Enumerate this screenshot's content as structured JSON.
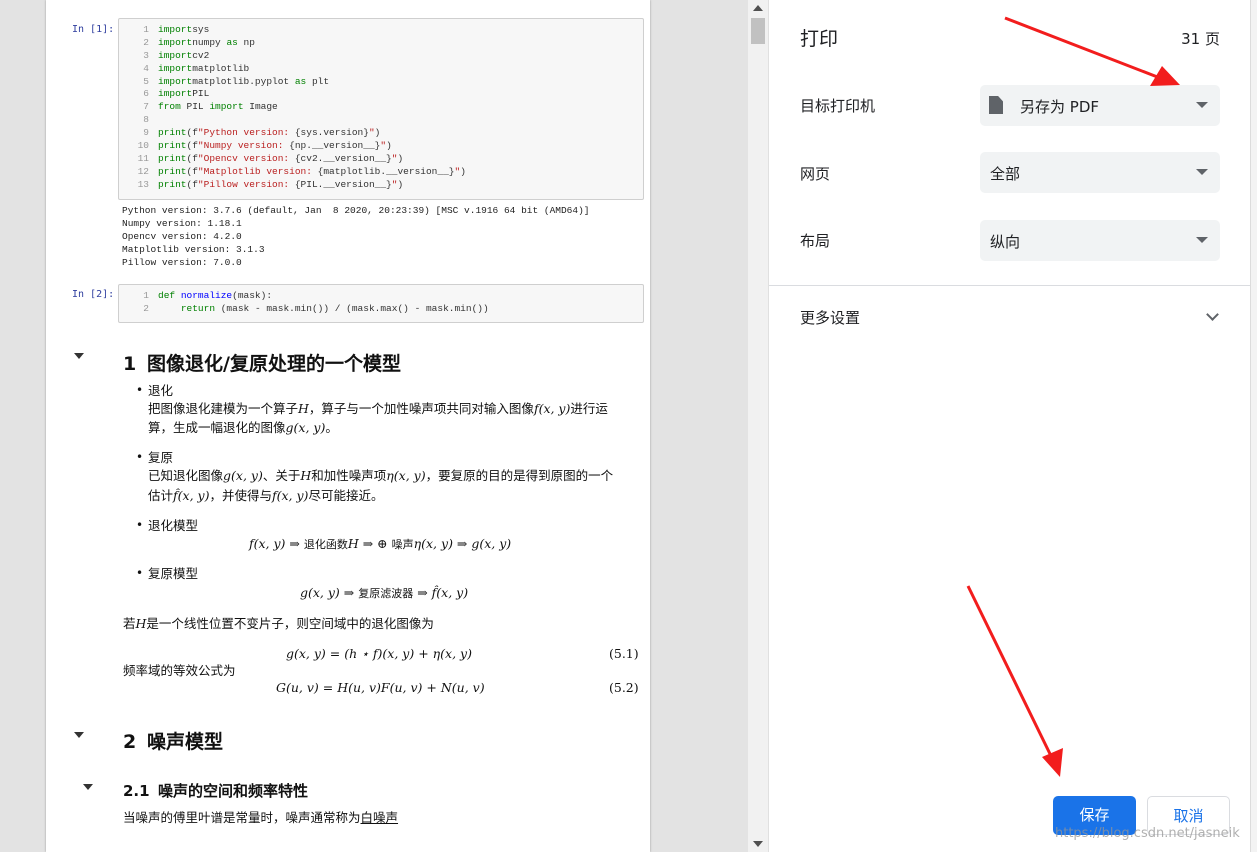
{
  "preview": {
    "cell1": {
      "prompt": "In  [1]:",
      "lines": [
        {
          "n": "1",
          "parts": [
            [
              "kw",
              "import"
            ],
            [
              "",
              "sys"
            ]
          ]
        },
        {
          "n": "2",
          "parts": [
            [
              "kw",
              "import"
            ],
            [
              "",
              "numpy "
            ],
            [
              "kw",
              "as"
            ],
            [
              "",
              " np"
            ]
          ]
        },
        {
          "n": "3",
          "parts": [
            [
              "kw",
              "import"
            ],
            [
              "",
              "cv2"
            ]
          ]
        },
        {
          "n": "4",
          "parts": [
            [
              "kw",
              "import"
            ],
            [
              "",
              "matplotlib"
            ]
          ]
        },
        {
          "n": "5",
          "parts": [
            [
              "kw",
              "import"
            ],
            [
              "",
              "matplotlib.pyplot "
            ],
            [
              "kw",
              "as"
            ],
            [
              "",
              " plt"
            ]
          ]
        },
        {
          "n": "6",
          "parts": [
            [
              "kw",
              "import"
            ],
            [
              "",
              "PIL"
            ]
          ]
        },
        {
          "n": "7",
          "parts": [
            [
              "kw",
              "from"
            ],
            [
              "",
              " PIL "
            ],
            [
              "kw",
              "import"
            ],
            [
              "",
              " Image"
            ]
          ]
        },
        {
          "n": "8",
          "parts": []
        },
        {
          "n": "9",
          "parts": [
            [
              "kw",
              "print"
            ],
            [
              "",
              "(f"
            ],
            [
              "str",
              "\"Python version: "
            ],
            [
              "",
              "{sys.version}"
            ],
            [
              "str",
              "\""
            ],
            [
              "",
              ")"
            ]
          ]
        },
        {
          "n": "10",
          "parts": [
            [
              "kw",
              "print"
            ],
            [
              "",
              "(f"
            ],
            [
              "str",
              "\"Numpy version: "
            ],
            [
              "",
              "{np.__version__}"
            ],
            [
              "str",
              "\""
            ],
            [
              "",
              ")"
            ]
          ]
        },
        {
          "n": "11",
          "parts": [
            [
              "kw",
              "print"
            ],
            [
              "",
              "(f"
            ],
            [
              "str",
              "\"Opencv version: "
            ],
            [
              "",
              "{cv2.__version__}"
            ],
            [
              "str",
              "\""
            ],
            [
              "",
              ")"
            ]
          ]
        },
        {
          "n": "12",
          "parts": [
            [
              "kw",
              "print"
            ],
            [
              "",
              "(f"
            ],
            [
              "str",
              "\"Matplotlib version: "
            ],
            [
              "",
              "{matplotlib.__version__}"
            ],
            [
              "str",
              "\""
            ],
            [
              "",
              ")"
            ]
          ]
        },
        {
          "n": "13",
          "parts": [
            [
              "kw",
              "print"
            ],
            [
              "",
              "(f"
            ],
            [
              "str",
              "\"Pillow version: "
            ],
            [
              "",
              "{PIL.__version__}"
            ],
            [
              "str",
              "\""
            ],
            [
              "",
              ")"
            ]
          ]
        }
      ],
      "output": [
        "Python version: 3.7.6 (default, Jan  8 2020, 20:23:39) [MSC v.1916 64 bit (AMD64)]",
        "Numpy version: 1.18.1",
        "Opencv version: 4.2.0",
        "Matplotlib version: 3.1.3",
        "Pillow version: 7.0.0"
      ]
    },
    "cell2": {
      "prompt": "In  [2]:",
      "collapse": "▾",
      "lines": [
        {
          "n": "1",
          "parts": [
            [
              "kw",
              "def "
            ],
            [
              "fn",
              "normalize"
            ],
            [
              "",
              "(mask):"
            ]
          ]
        },
        {
          "n": "2",
          "parts": [
            [
              "",
              "    "
            ],
            [
              "kw",
              "return"
            ],
            [
              "",
              " (mask - mask.min()) / (mask.max() - mask.min())"
            ]
          ]
        }
      ]
    },
    "section1": {
      "num": "1",
      "title": "图像退化/复原处理的一个模型",
      "b1_title": "退化",
      "b1_l1_a": "把图像退化建模为一个算子",
      "b1_l1_H": "H",
      "b1_l1_b": "，算子与一个加性噪声项共同对输入图像",
      "b1_l1_f": "f(x, y)",
      "b1_l1_c": "进行运",
      "b1_l2_a": "算，生成一幅退化的图像",
      "b1_l2_g": "g(x, y)",
      "b1_l2_b": "。",
      "b2_title": "复原",
      "b2_l1_a": "已知退化图像",
      "b2_l1_g": "g(x, y)",
      "b2_l1_b": "、关于",
      "b2_l1_H": "H",
      "b2_l1_c": "和加性噪声项",
      "b2_l1_eta": "η(x, y)",
      "b2_l1_d": "，要复原的目的是得到原图的一个",
      "b2_l2_a": "估计",
      "b2_l2_fh": "f̂(x, y)",
      "b2_l2_b": "，并使得与",
      "b2_l2_f": "f(x, y)",
      "b2_l2_c": "尽可能接近。",
      "b3_title": "退化模型",
      "b3_eq_a": "f(x, y) ⇒ ",
      "b3_eq_cn": "退化函数",
      "b3_eq_b": "H ⇒ ⊕ ",
      "b3_eq_cn2": "噪声",
      "b3_eq_c": "η(x, y) ⇒ g(x, y)",
      "b4_title": "复原模型",
      "b4_eq_a": "g(x, y) ⇒ ",
      "b4_eq_cn": "复原滤波器",
      "b4_eq_b": " ⇒ f̂(x, y)",
      "p1_a": "若",
      "p1_H": "H",
      "p1_b": "是一个线性位置不变片子，则空间域中的退化图像为",
      "eq51": "g(x, y) = (h ⋆ f)(x, y) + η(x, y)",
      "eq51_num": "(5.1)",
      "p2": "频率域的等效公式为",
      "eq52": "G(u, v) = H(u, v)F(u, v) + N(u, v)",
      "eq52_num": "(5.2)"
    },
    "section2": {
      "num": "2",
      "title": "噪声模型",
      "sub_num": "2.1",
      "sub_title": "噪声的空间和频率特性",
      "p_a": "当噪声的傅里叶谱是常量时，噪声通常称为",
      "p_link": "白噪声"
    }
  },
  "print": {
    "title": "打印",
    "pages": "31 页",
    "destination_label": "目标打印机",
    "destination_value": "另存为 PDF",
    "pages_label": "网页",
    "pages_value": "全部",
    "layout_label": "布局",
    "layout_value": "纵向",
    "more_settings": "更多设置",
    "save_button": "保存",
    "cancel_button": "取消",
    "accent_color": "#1a73e8"
  },
  "watermark": "https://blog.csdn.net/jasneik"
}
